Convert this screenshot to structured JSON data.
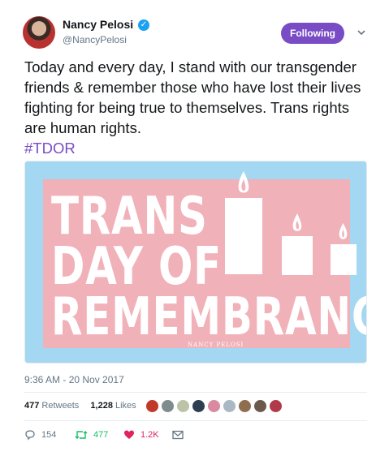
{
  "author": {
    "name": "Nancy Pelosi",
    "handle": "@NancyPelosi",
    "verified_icon": "verified-badge-icon",
    "follow_label": "Following",
    "accent_color": "#794bc4"
  },
  "tweet": {
    "text": "Today and every day, I stand with our transgender friends & remember those who have lost their lives fighting for being true to themselves. Trans rights are human rights.",
    "hashtag": "#TDOR",
    "timestamp": "9:36 AM - 20 Nov 2017"
  },
  "media": {
    "line1": "TRANS",
    "line2": "DAY OF",
    "line3": "REMEMBRANCE",
    "watermark": "NANCY PELOSI",
    "colors": {
      "blue": "#a3d7f2",
      "pink": "#f1b1b8",
      "white": "#ffffff"
    }
  },
  "stats": {
    "retweets_count": "477",
    "retweets_label": "Retweets",
    "likes_count": "1,228",
    "likes_label": "Likes"
  },
  "actions": {
    "reply_count": "154",
    "retweet_count": "477",
    "like_count": "1.2K",
    "reply_icon": "reply-icon",
    "retweet_icon": "retweet-icon",
    "like_icon": "heart-icon",
    "dm_icon": "envelope-icon"
  }
}
